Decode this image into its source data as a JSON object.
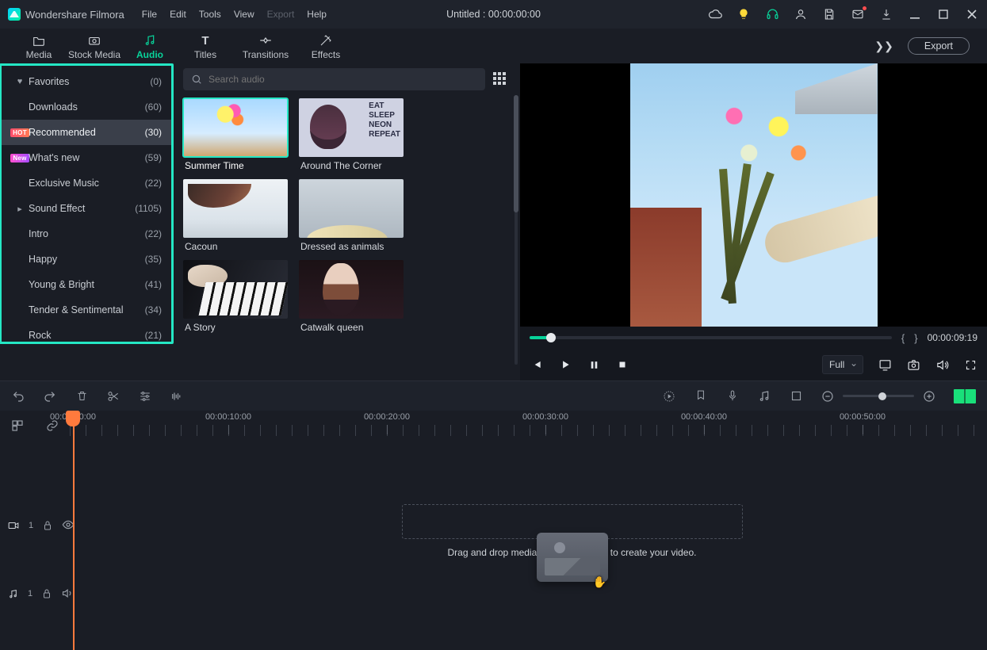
{
  "app": {
    "brand": "Wondershare Filmora",
    "doc_title": "Untitled : 00:00:00:00"
  },
  "menus": {
    "file": "File",
    "edit": "Edit",
    "tools": "Tools",
    "view": "View",
    "export": "Export",
    "help": "Help"
  },
  "tabs": {
    "media": "Media",
    "stock": "Stock Media",
    "audio": "Audio",
    "titles": "Titles",
    "transitions": "Transitions",
    "effects": "Effects",
    "export_btn": "Export"
  },
  "search": {
    "placeholder": "Search audio"
  },
  "sidebar": {
    "items": [
      {
        "name": "Favorites",
        "count": "(0)",
        "lead": "heart"
      },
      {
        "name": "Downloads",
        "count": "(60)",
        "lead": ""
      },
      {
        "name": "Recommended",
        "count": "(30)",
        "lead": "hot"
      },
      {
        "name": "What's new",
        "count": "(59)",
        "lead": "new"
      },
      {
        "name": "Exclusive Music",
        "count": "(22)",
        "lead": ""
      },
      {
        "name": "Sound Effect",
        "count": "(1105)",
        "lead": "caret"
      },
      {
        "name": "Intro",
        "count": "(22)",
        "lead": ""
      },
      {
        "name": "Happy",
        "count": "(35)",
        "lead": ""
      },
      {
        "name": "Young & Bright",
        "count": "(41)",
        "lead": ""
      },
      {
        "name": "Tender & Sentimental",
        "count": "(34)",
        "lead": ""
      },
      {
        "name": "Rock",
        "count": "(21)",
        "lead": ""
      }
    ],
    "badges": {
      "hot": "HOT",
      "new": "New"
    }
  },
  "cards": [
    {
      "title": "Summer Time",
      "art": "th-summer",
      "selected": true
    },
    {
      "title": "Around The Corner",
      "art": "th-corner"
    },
    {
      "title": "Cacoun",
      "art": "th-cacoun"
    },
    {
      "title": "Dressed as animals",
      "art": "th-dressed"
    },
    {
      "title": "A Story",
      "art": "th-story"
    },
    {
      "title": "Catwalk queen",
      "art": "th-catwalk"
    }
  ],
  "preview": {
    "timecode": "00:00:09:19",
    "quality": "Full"
  },
  "ruler": {
    "labels": [
      "00:00:00:00",
      "00:00:10:00",
      "00:00:20:00",
      "00:00:30:00",
      "00:00:40:00",
      "00:00:50:00"
    ]
  },
  "tracks": {
    "video_label": "1",
    "audio_label": "1"
  },
  "drop": {
    "text": "Drag and drop media and effects here to create your video."
  }
}
